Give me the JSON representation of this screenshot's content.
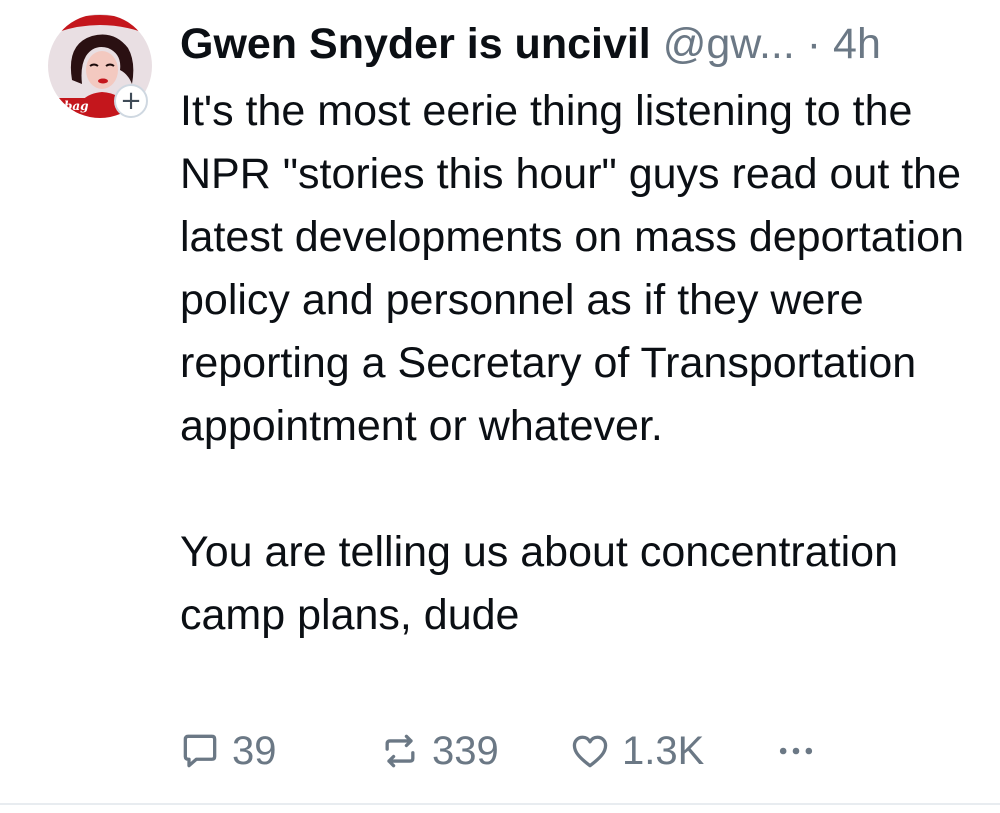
{
  "post": {
    "author": {
      "display_name": "Gwen Snyder is uncivil",
      "handle": "@gw...",
      "avatar_text": "a bag"
    },
    "separator": "·",
    "time": "4h",
    "follow_icon": "plus-icon",
    "body_paragraphs": [
      "It's the most eerie thing listening to the NPR \"stories this hour\" guys read out the latest developments on mass deportation policy and personnel as if they were reporting a Secretary of Transportation appointment or whatever.",
      "You are telling us about concentration camp plans, dude"
    ],
    "stats": {
      "replies": "39",
      "reposts": "339",
      "likes": "1.3K"
    },
    "icons": {
      "reply": "speech-bubble-icon",
      "repost": "repost-arrows-icon",
      "like": "heart-icon",
      "more": "ellipsis-icon"
    },
    "colors": {
      "text": "#0b0f14",
      "muted": "#6b7885",
      "avatar_accent": "#c4161c"
    }
  }
}
